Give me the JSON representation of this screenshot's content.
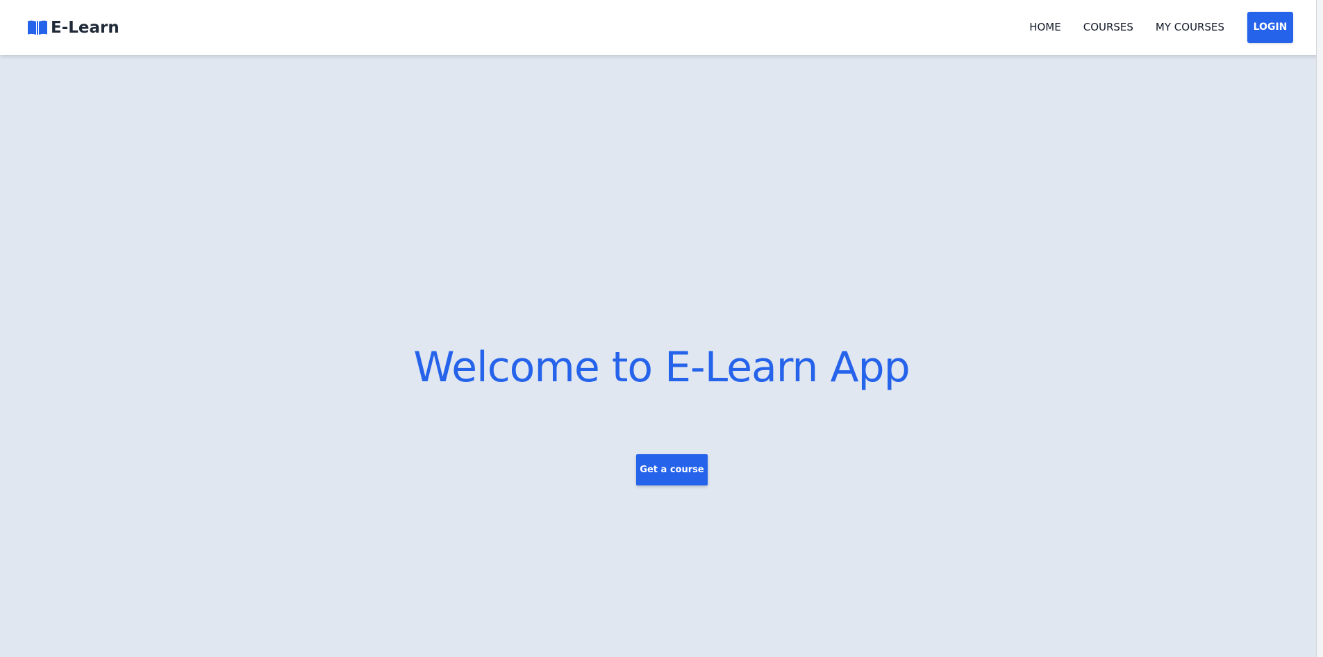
{
  "app": {
    "brand_name": "E-Learn",
    "brand_icon": "book-open-icon"
  },
  "navigation": {
    "items": [
      {
        "label": "HOME"
      },
      {
        "label": "COURSES"
      },
      {
        "label": "MY COURSES"
      }
    ],
    "login_label": "LOGIN"
  },
  "hero": {
    "title": "Welcome to E-Learn App",
    "cta_label": "Get a course"
  },
  "colors": {
    "accent": "#2563eb",
    "page_background": "#e1e7f0",
    "navbar_background": "#ffffff",
    "text_dark": "#111827"
  }
}
